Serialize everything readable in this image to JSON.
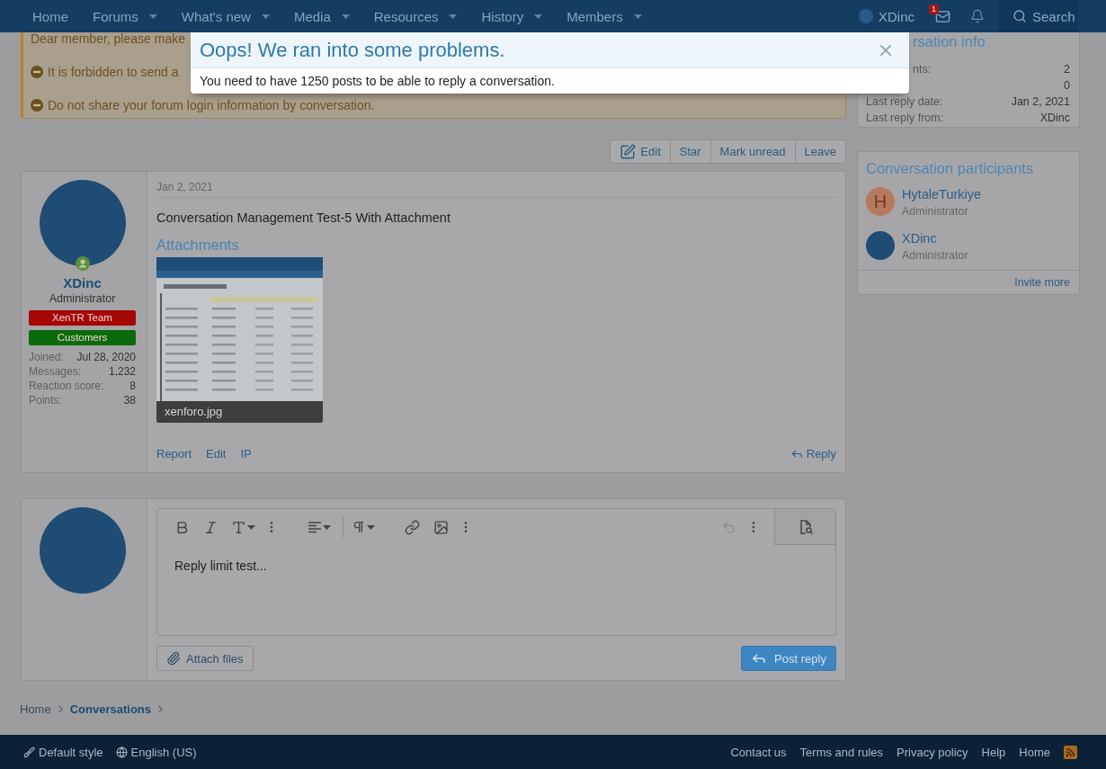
{
  "nav": {
    "tabs": [
      {
        "label": "Home",
        "dropdown": false
      },
      {
        "label": "Forums",
        "dropdown": true
      },
      {
        "label": "What's new",
        "dropdown": true
      },
      {
        "label": "Media",
        "dropdown": true
      },
      {
        "label": "Resources",
        "dropdown": true
      },
      {
        "label": "History",
        "dropdown": true
      },
      {
        "label": "Members",
        "dropdown": true
      }
    ],
    "user": {
      "name": "XDinc"
    },
    "inbox_badge": "1",
    "search_label": "Search"
  },
  "notice": {
    "lines": [
      {
        "kind": "plain",
        "text": "Dear member, please make"
      },
      {
        "kind": "rule",
        "text": "It is forbidden to send a"
      },
      {
        "kind": "rule",
        "text": "Do not share your forum login information by conversation."
      }
    ]
  },
  "dialog": {
    "title": "Oops! We ran into some problems.",
    "message": "You need to have 1250 posts to be able to reply a conversation."
  },
  "sidebar": {
    "conversation_info": {
      "clipped_title": "rsation info",
      "rows": [
        {
          "clipped_label": "nts:",
          "value": "2"
        },
        {
          "value": "0"
        },
        {
          "label": "Last reply date:",
          "value": "Jan 2, 2021"
        },
        {
          "label": "Last reply from:",
          "value": "XDinc"
        }
      ]
    },
    "participants": {
      "title": "Conversation participants",
      "people": [
        {
          "name": "HytaleTurkiye",
          "role": "Administrator",
          "avatar": {
            "kind": "letter",
            "letter": "H"
          }
        },
        {
          "name": "XDinc",
          "role": "Administrator",
          "avatar": {
            "kind": "logo"
          }
        }
      ],
      "invite": "Invite more"
    }
  },
  "conversation_actions": [
    {
      "kind": "edit",
      "label": "Edit"
    },
    {
      "kind": "plain",
      "label": "Star"
    },
    {
      "kind": "plain",
      "label": "Mark unread"
    },
    {
      "kind": "plain",
      "label": "Leave"
    }
  ],
  "post": {
    "author": {
      "name": "XDinc",
      "title": "Administrator",
      "online": true,
      "banners": [
        {
          "label": "XenTR Team",
          "color": "#a50606"
        },
        {
          "label": "Customers",
          "color": "#0b6a0b"
        }
      ],
      "stats": [
        {
          "label": "Joined:",
          "value": "Jul 28, 2020"
        },
        {
          "label": "Messages:",
          "value": "1,232"
        },
        {
          "label": "Reaction score:",
          "value": "8"
        },
        {
          "label": "Points:",
          "value": "38"
        }
      ]
    },
    "date": "Jan 2, 2021",
    "body": "Conversation Management Test-5 With Attachment",
    "attachments_title": "Attachments",
    "attachment": {
      "filename": "xenforo.jpg"
    },
    "links": [
      "Report",
      "Edit",
      "IP"
    ],
    "reply": "Reply"
  },
  "reply_editor": {
    "undo": {
      "disabled": true
    },
    "content": "Reply limit test...",
    "attach_label": "Attach files",
    "submit_label": "Post reply"
  },
  "breadcrumb": [
    {
      "label": "Home",
      "current": false
    },
    {
      "label": "Conversations",
      "current": true
    }
  ],
  "footer": {
    "options": [
      {
        "kind": "style",
        "label": "Default style"
      },
      {
        "kind": "language",
        "label": "English (US)"
      }
    ],
    "links": [
      "Contact us",
      "Terms and rules",
      "Privacy policy",
      "Help",
      "Home"
    ]
  }
}
